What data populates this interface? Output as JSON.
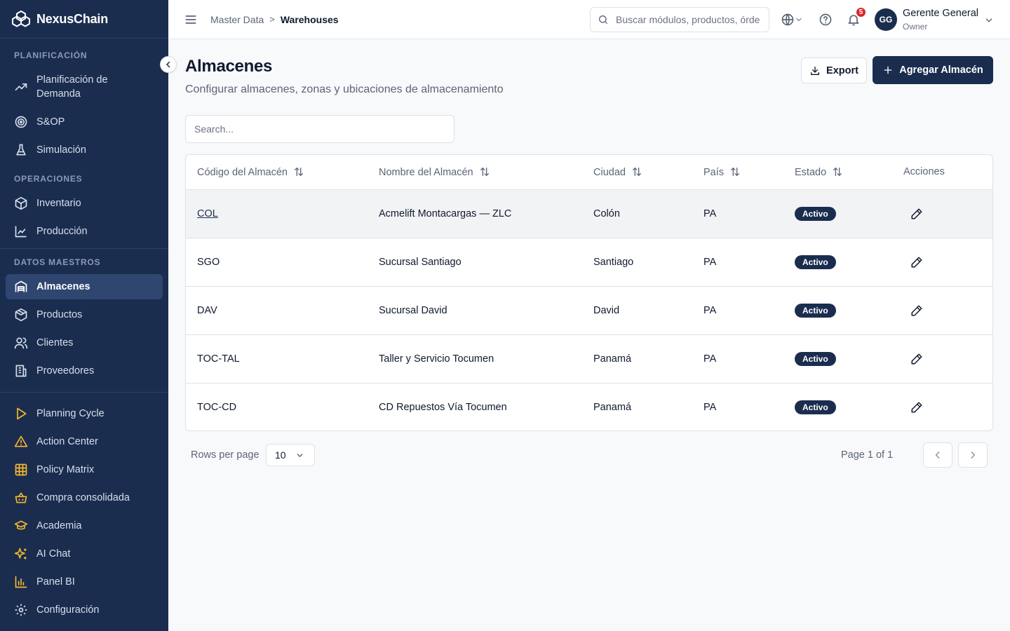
{
  "app": {
    "name": "NexusChain"
  },
  "sidebar": {
    "sections": [
      {
        "title": "PLANIFICACIÓN",
        "items": [
          "Planificación de Demanda",
          "S&OP",
          "Simulación"
        ]
      },
      {
        "title": "OPERACIONES",
        "items": [
          "Inventario",
          "Producción"
        ]
      },
      {
        "title": "DATOS MAESTROS",
        "items": [
          "Almacenes",
          "Productos",
          "Clientes",
          "Proveedores"
        ]
      }
    ],
    "extras": [
      "Planning Cycle",
      "Action Center",
      "Policy Matrix",
      "Compra consolidada",
      "Academia",
      "AI Chat",
      "Panel BI",
      "Configuración"
    ],
    "active": "Almacenes"
  },
  "header": {
    "breadcrumb": {
      "parent": "Master Data",
      "separator": ">",
      "current": "Warehouses"
    },
    "search_placeholder": "Buscar módulos, productos, órdenes...",
    "notifications_count": "5",
    "user": {
      "initials": "GG",
      "name": "Gerente General",
      "role": "Owner"
    }
  },
  "page": {
    "title": "Almacenes",
    "subtitle": "Configurar almacenes, zonas y ubicaciones de almacenamiento",
    "export_label": "Export",
    "add_label": "Agregar Almacén",
    "search_placeholder": "Search..."
  },
  "table": {
    "columns": [
      "Código del Almacén",
      "Nombre del Almacén",
      "Ciudad",
      "País",
      "Estado",
      "Acciones"
    ],
    "rows": [
      {
        "code": "COL",
        "name": "Acmelift Montacargas — ZLC",
        "city": "Colón",
        "country": "PA",
        "status": "Activo"
      },
      {
        "code": "SGO",
        "name": "Sucursal Santiago",
        "city": "Santiago",
        "country": "PA",
        "status": "Activo"
      },
      {
        "code": "DAV",
        "name": "Sucursal David",
        "city": "David",
        "country": "PA",
        "status": "Activo"
      },
      {
        "code": "TOC-TAL",
        "name": "Taller y Servicio Tocumen",
        "city": "Panamá",
        "country": "PA",
        "status": "Activo"
      },
      {
        "code": "TOC-CD",
        "name": "CD Repuestos Vía Tocumen",
        "city": "Panamá",
        "country": "PA",
        "status": "Activo"
      }
    ]
  },
  "pagination": {
    "rows_label": "Rows per page",
    "rows_value": "10",
    "page_info": "Page 1 of 1"
  },
  "colors": {
    "sidebar_bg": "#1b2d4f",
    "accent": "#1b2d4f",
    "extra_icon": "#f5b82e"
  }
}
